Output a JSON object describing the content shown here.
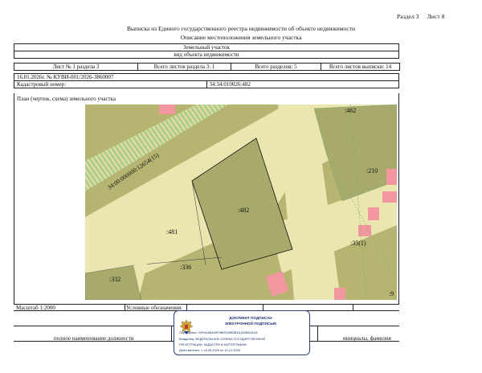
{
  "header": {
    "section": "Раздел 3",
    "sheet": "Лист 8",
    "title": "Выписка из Единого государственного реестра недвижимости об объекте недвижимости",
    "subtitle": "Описание местоположения земельного участка"
  },
  "object": {
    "type": "Земельный участок",
    "type_caption": "вид объекта недвижимости"
  },
  "sheet_info": {
    "sheet_of_section": "Лист № 1 раздела 3",
    "total_section_sheets": "Всего листов раздела 3: 1",
    "total_sections": "Всего разделов: 5",
    "total_sheets": "Всего листов выписки: 14"
  },
  "doc": {
    "number": "16.01.2026г. № КУВИ-001/2026-3860007",
    "cadastral_label": "Кадастровый номер:",
    "cadastral_value": "34:34:010026:482"
  },
  "plan": {
    "caption": "План (чертеж, схема) земельного участка",
    "labels": {
      "road": "34:00:000000:12654(15)",
      "p482_top": ":462",
      "p482_center": ":482",
      "p481": ":481",
      "p336": ":336",
      "p332": ":332",
      "p210": ":210",
      "p35": ":35(1)",
      "p9": ":9"
    },
    "colors": {
      "land": "#b6b471",
      "plot": "#a7aa6b",
      "road": "#ebe6b0",
      "building": "#f2979f",
      "stripe": "#9fcc85"
    }
  },
  "footer": {
    "scale": "Масштаб 1:2000",
    "legend": "Условные обозначения:",
    "position": "полное наименование должности",
    "name": "инициалы, фамилия"
  },
  "stamp": {
    "line1": "ДОКУМЕНТ ПОДПИСАН",
    "line2": "ЭЛЕКТРОННОЙ ПОДПИСЬЮ",
    "cert": "Сертификат: 00FA4A5A49F9B2D9AB0B1A1A0BA1A1A",
    "owner1": "Владелец: ФЕДЕРАЛЬНАЯ СЛУЖБА ГОСУДАРСТВЕННОЙ",
    "owner2": "РЕГИСТРАЦИИ, КАДАСТРА И КАРТОГРАФИИ",
    "valid": "Действителен: с 16.09.2025 по 10.12.2026"
  }
}
